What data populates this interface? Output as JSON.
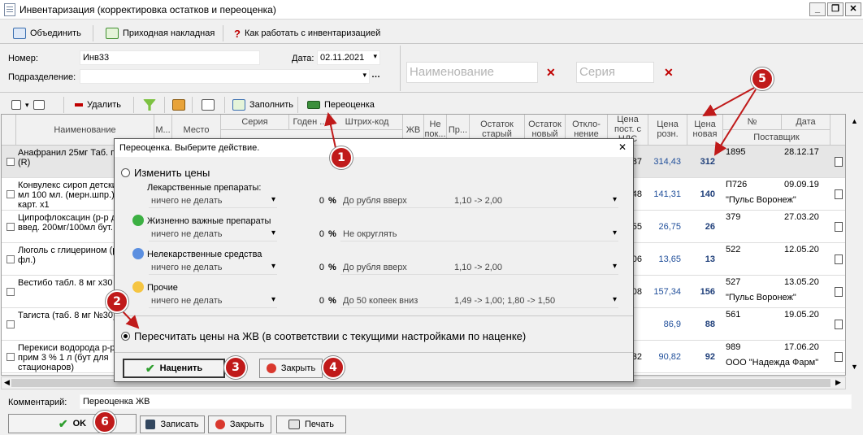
{
  "window": {
    "title": "Инвентаризация (корректировка остатков и переоценка)"
  },
  "toolbar1": {
    "merge": "Объединить",
    "invoice": "Приходная накладная",
    "help": "Как работать с инвентаризацией"
  },
  "form": {
    "number_label": "Номер:",
    "number_value": "Инв33",
    "date_label": "Дата:",
    "date_value": "02.11.2021",
    "dept_label": "Подразделение:",
    "dept_value": "",
    "name_placeholder": "Наименование",
    "series_placeholder": "Серия"
  },
  "toolbar2": {
    "delete": "Удалить",
    "fill": "Заполнить",
    "reprice": "Переоценка"
  },
  "grid": {
    "headers": {
      "name": "Наименование",
      "m": "М...",
      "place": "Место",
      "series": "Серия",
      "valid": "Годен ...",
      "barcode": "Штрих-код",
      "zhv": "ЖВ",
      "ne_pok": "Не пок...",
      "pr": "Пр...",
      "ost_old": "Остаток старый",
      "ost_new": "Остаток новый",
      "deviation": "Откло-нение",
      "price_post": "Цена пост. с НДС",
      "price_retail": "Цена розн.",
      "price_new": "Цена новая",
      "no": "№",
      "date": "Дата",
      "supplier": "Поставщик"
    },
    "rows": [
      {
        "name": "Анафранил 25мг Таб. п/о №30 (R)",
        "post_tail": "87",
        "retail": "314,43",
        "new": "312",
        "no": "1895",
        "date": "28.12.17",
        "supplier": ""
      },
      {
        "name": "Конвулекс сироп детский 50 мг/мл 100 мл. (мерн.шпр.) фл. пач. карт. x1",
        "post_tail": "48",
        "retail": "141,31",
        "new": "140",
        "no": "П726",
        "date": "09.09.19",
        "supplier": "\"Пульс Воронеж\""
      },
      {
        "name": "Ципрофлоксацин (р-р для в/в введ. 200мг/100мл бут. конт. чл.)",
        "post_tail": "55",
        "retail": "26,75",
        "new": "26",
        "no": "379",
        "date": "27.03.20",
        "supplier": ""
      },
      {
        "name": "Люголь с глицерином (р-р 25г фл.)",
        "post_tail": "06",
        "retail": "13,65",
        "new": "13",
        "no": "522",
        "date": "12.05.20",
        "supplier": ""
      },
      {
        "name": "Вестибо табл. 8 мг x30",
        "post_tail": "08",
        "retail": "157,34",
        "new": "156",
        "no": "527",
        "date": "13.05.20",
        "supplier": "\"Пульс Воронеж\""
      },
      {
        "name": "Тагиста (таб. 8 мг №30)",
        "post_tail": "",
        "retail": "86,9",
        "new": "88",
        "no": "561",
        "date": "19.05.20",
        "supplier": ""
      },
      {
        "name": "Перекиси водорода р-р д/наруж прим 3 % 1 л (бут для стационаров)",
        "post_tail": "32",
        "retail": "90,82",
        "new": "92",
        "no": "989",
        "date": "17.06.20",
        "supplier": "ООО \"Надежда Фарм\""
      }
    ]
  },
  "dialog": {
    "title": "Переоценка. Выберите действие.",
    "opt_change": "Изменить цены",
    "groups": [
      {
        "label": "Лекарственные препараты:",
        "action": "ничего не делать",
        "pct": "0",
        "round": "До рубля вверх",
        "example": "1,10 -> 2,00",
        "dot": "none"
      },
      {
        "label": "Жизненно важные препараты",
        "action": "ничего не делать",
        "pct": "0",
        "round": "Не округлять",
        "example": "",
        "dot": "#3cb043"
      },
      {
        "label": "Нелекарственные средства",
        "action": "ничего не делать",
        "pct": "0",
        "round": "До рубля вверх",
        "example": "1,10 -> 2,00",
        "dot": "#5b8fe0"
      },
      {
        "label": "Прочие",
        "action": "ничего не делать",
        "pct": "0",
        "round": "До 50 копеек вниз",
        "example": "1,49 -> 1,00;   1,80 -> 1,50",
        "dot": "#f5c542"
      }
    ],
    "pct_sign": "%",
    "opt_recalc": "Пересчитать цены на ЖВ (в соответствии с текущими настройками по наценке)",
    "btn_apply": "Наценить",
    "btn_close": "Закрыть"
  },
  "footer": {
    "comment_label": "Комментарий:",
    "comment_value": "Переоценка ЖВ",
    "ok": "OK",
    "save": "Записать",
    "close": "Закрыть",
    "print": "Печать"
  },
  "badges": [
    "1",
    "2",
    "3",
    "4",
    "5",
    "6"
  ],
  "colors": {
    "badge": "#c01a1a",
    "value_blue": "#1f4e9a",
    "x_red": "#c00000"
  }
}
